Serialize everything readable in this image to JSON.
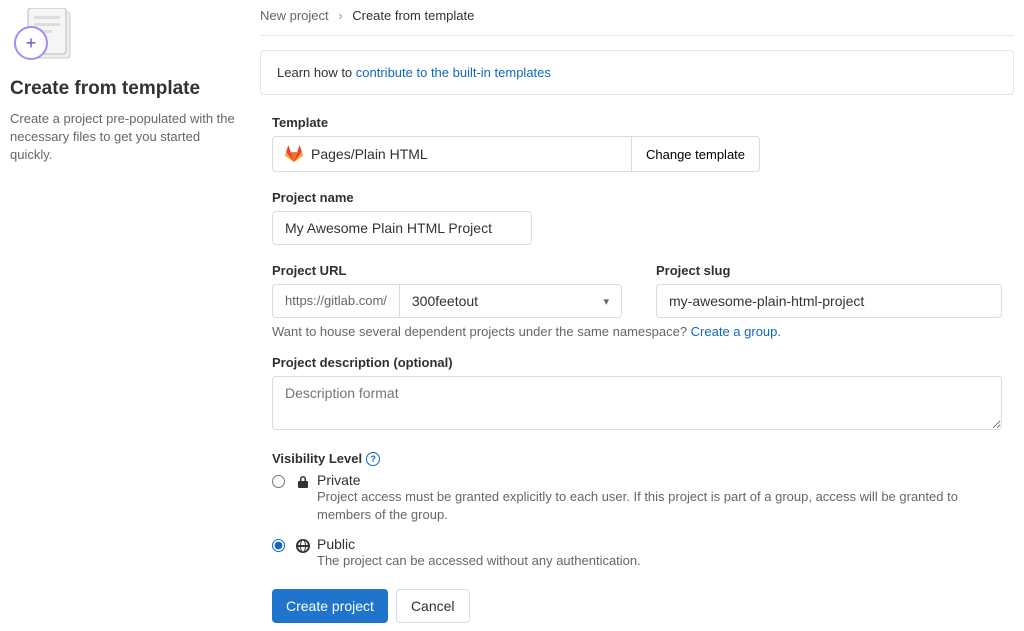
{
  "sidebar": {
    "title": "Create from template",
    "description": "Create a project pre-populated with the necessary files to get you started quickly."
  },
  "breadcrumb": {
    "parent": "New project",
    "current": "Create from template"
  },
  "info": {
    "prefix": "Learn how to ",
    "link": "contribute to the built-in templates"
  },
  "template": {
    "label": "Template",
    "name": "Pages/Plain HTML",
    "change": "Change template"
  },
  "project_name": {
    "label": "Project name",
    "value": "My Awesome Plain HTML Project"
  },
  "project_url": {
    "label": "Project URL",
    "prefix": "https://gitlab.com/",
    "namespace": "300feetout"
  },
  "project_slug": {
    "label": "Project slug",
    "value": "my-awesome-plain-html-project"
  },
  "namespace_hint": {
    "text": "Want to house several dependent projects under the same namespace? ",
    "link": "Create a group."
  },
  "description": {
    "label": "Project description (optional)",
    "placeholder": "Description format"
  },
  "visibility": {
    "label": "Visibility Level",
    "options": [
      {
        "title": "Private",
        "desc": "Project access must be granted explicitly to each user. If this project is part of a group, access will be granted to members of the group.",
        "checked": false
      },
      {
        "title": "Public",
        "desc": "The project can be accessed without any authentication.",
        "checked": true
      }
    ]
  },
  "buttons": {
    "submit": "Create project",
    "cancel": "Cancel"
  }
}
